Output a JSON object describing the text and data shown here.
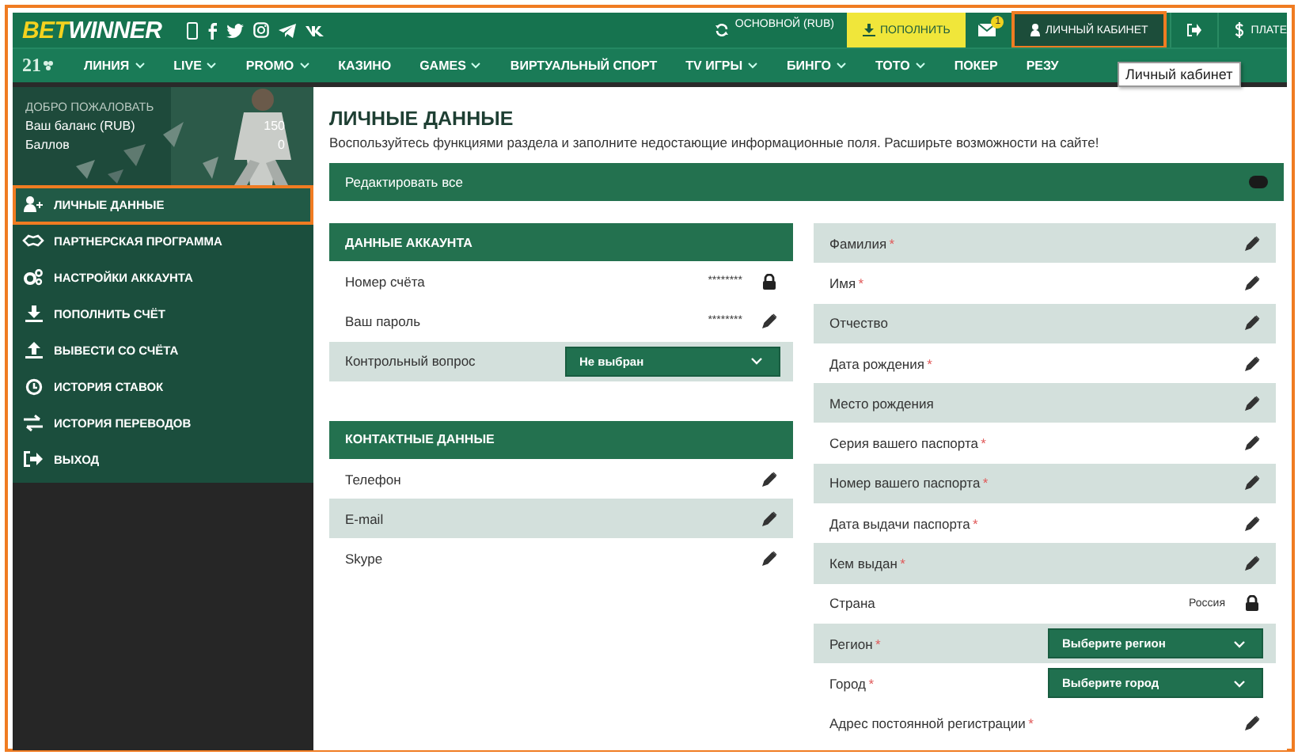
{
  "header": {
    "logo": {
      "part_1": "BET",
      "part_2": "WINNER"
    },
    "account": {
      "label": "ОСНОВНОЙ",
      "currency": "(RUB)"
    },
    "deposit_button": "ПОПОЛНИТЬ",
    "messages_badge": "1",
    "cabinet_button": {
      "label": "ЛИЧНЫЙ КАБИНЕТ",
      "highlighted": true
    },
    "payments_button": "ПЛАТЕ"
  },
  "nav": {
    "age_badge": "21",
    "items": [
      {
        "label": "ЛИНИЯ",
        "dropdown": true
      },
      {
        "label": "LIVE",
        "dropdown": true
      },
      {
        "label": "PROMO",
        "dropdown": true
      },
      {
        "label": "КАЗИНО",
        "dropdown": false
      },
      {
        "label": "GAMES",
        "dropdown": true
      },
      {
        "label": "ВИРТУАЛЬНЫЙ СПОРТ",
        "dropdown": false
      },
      {
        "label": "TV ИГРЫ",
        "dropdown": true
      },
      {
        "label": "БИНГО",
        "dropdown": true
      },
      {
        "label": "ТОТО",
        "dropdown": true
      },
      {
        "label": "ПОКЕР",
        "dropdown": false
      },
      {
        "label": "РЕЗУ",
        "dropdown": false
      }
    ]
  },
  "tooltip": "Личный кабинет",
  "sidebar": {
    "welcome": "ДОБРО ПОЖАЛОВАТЬ",
    "balances": [
      {
        "label": "Ваш баланс (RUB)",
        "value": "150"
      },
      {
        "label": "Баллов",
        "value": "0"
      }
    ],
    "items": [
      {
        "label": "ЛИЧНЫЕ ДАННЫЕ",
        "selected": true
      },
      {
        "label": "ПАРТНЕРСКАЯ ПРОГРАММА",
        "selected": false
      },
      {
        "label": "НАСТРОЙКИ АККАУНТА",
        "selected": false
      },
      {
        "label": "ПОПОЛНИТЬ СЧЁТ",
        "selected": false
      },
      {
        "label": "ВЫВЕСТИ СО СЧЁТА",
        "selected": false
      },
      {
        "label": "ИСТОРИЯ СТАВОК",
        "selected": false
      },
      {
        "label": "ИСТОРИЯ ПЕРЕВОДОВ",
        "selected": false
      },
      {
        "label": "ВЫХОД",
        "selected": false
      }
    ]
  },
  "main": {
    "title": "ЛИЧНЫЕ ДАННЫЕ",
    "subtitle": "Воспользуйтесь функциями раздела и заполните недостающие информационные поля. Расширьте возможности на сайте!",
    "edit_all": {
      "label": "Редактировать все",
      "on": false
    },
    "account_panel": {
      "title": "ДАННЫЕ АККАУНТА",
      "rows": [
        {
          "kind": "text",
          "label": "Номер счёта",
          "value": "********",
          "locked": true,
          "shaded": false
        },
        {
          "kind": "text",
          "label": "Ваш пароль",
          "value": "********",
          "locked": false,
          "shaded": false
        },
        {
          "kind": "select",
          "label": "Контрольный вопрос",
          "value": "Не выбран",
          "shaded": true
        }
      ]
    },
    "contacts_panel": {
      "title": "КОНТАКТНЫЕ ДАННЫЕ",
      "rows": [
        {
          "kind": "text",
          "label": "Телефон",
          "locked": false,
          "shaded": false
        },
        {
          "kind": "text",
          "label": "E-mail",
          "locked": false,
          "shaded": true
        },
        {
          "kind": "text",
          "label": "Skype",
          "locked": false,
          "shaded": false
        }
      ]
    },
    "personal_rows": [
      {
        "kind": "text",
        "label": "Фамилия",
        "required_mark": "*",
        "locked": false,
        "shaded": true
      },
      {
        "kind": "text",
        "label": "Имя",
        "required_mark": "*",
        "locked": false,
        "shaded": false
      },
      {
        "kind": "text",
        "label": "Отчество",
        "locked": false,
        "shaded": true
      },
      {
        "kind": "text",
        "label": "Дата рождения",
        "required_mark": "*",
        "locked": false,
        "shaded": false
      },
      {
        "kind": "text",
        "label": "Место рождения",
        "locked": false,
        "shaded": true
      },
      {
        "kind": "text",
        "label": "Серия вашего паспорта",
        "required_mark": "*",
        "locked": false,
        "shaded": false
      },
      {
        "kind": "text",
        "label": "Номер вашего паспорта",
        "required_mark": "*",
        "locked": false,
        "shaded": true
      },
      {
        "kind": "text",
        "label": "Дата выдачи паспорта",
        "required_mark": "*",
        "locked": false,
        "shaded": false
      },
      {
        "kind": "text",
        "label": "Кем выдан",
        "required_mark": "*",
        "locked": false,
        "shaded": true
      },
      {
        "kind": "text",
        "label": "Страна",
        "value": "Россия",
        "locked": true,
        "shaded": false
      },
      {
        "kind": "select",
        "label": "Регион",
        "required_mark": "*",
        "value": "Выберите регион",
        "shaded": true
      },
      {
        "kind": "select",
        "label": "Город",
        "required_mark": "*",
        "value": "Выберите город",
        "shaded": false
      },
      {
        "kind": "text",
        "label": "Адрес постоянной регистрации",
        "required_mark": "*",
        "locked": false,
        "shaded": false
      }
    ]
  }
}
